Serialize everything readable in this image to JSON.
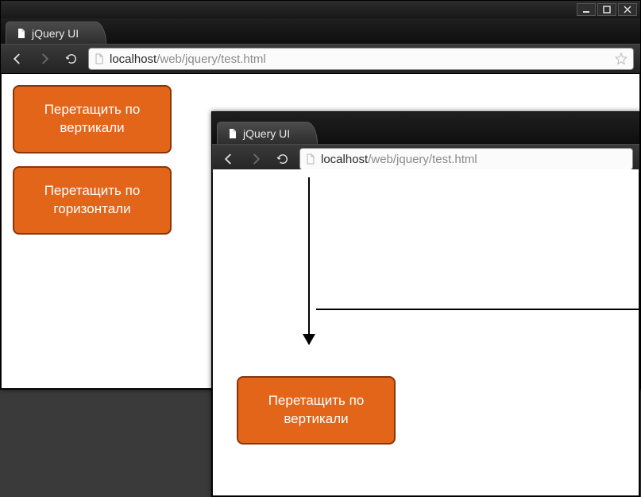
{
  "backWindow": {
    "tabTitle": "jQuery UI",
    "urlHost": "localhost",
    "urlPath": "/web/jquery/test.html",
    "boxes": {
      "vertical": "Перетащить по вертикали",
      "horizontal": "Перетащить по горизонтали"
    }
  },
  "frontWindow": {
    "tabTitle": "jQuery UI",
    "urlHost": "localhost",
    "urlPath": "/web/jquery/test.html",
    "boxes": {
      "vertical": "Перетащить по вертикали"
    }
  }
}
